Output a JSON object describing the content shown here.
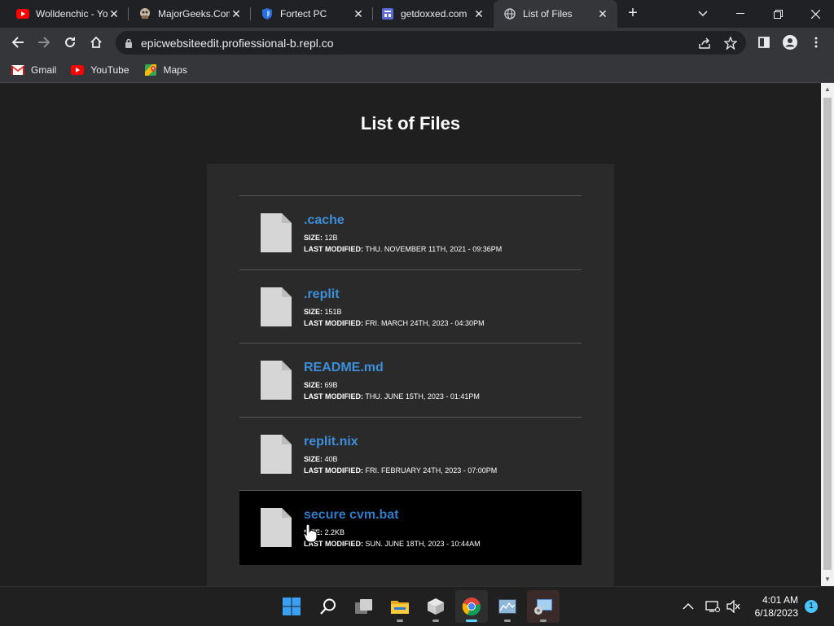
{
  "browser": {
    "tabs": [
      {
        "title": "Wolldenchic - Yo",
        "favicon": "youtube-icon"
      },
      {
        "title": "MajorGeeks.Com",
        "favicon": "majorgeeks-icon"
      },
      {
        "title": "Fortect PC",
        "favicon": "fortect-shield-icon"
      },
      {
        "title": "getdoxxed.com",
        "favicon": "getdoxxed-icon"
      },
      {
        "title": "List of Files",
        "favicon": "globe-icon",
        "active": true
      }
    ],
    "url": "epicwebsiteedit.profiessional-b.repl.co",
    "bookmarks": [
      {
        "label": "Gmail",
        "icon": "gmail-icon"
      },
      {
        "label": "YouTube",
        "icon": "youtube-icon"
      },
      {
        "label": "Maps",
        "icon": "maps-icon"
      }
    ]
  },
  "page": {
    "title": "List of Files",
    "size_label": "SIZE:",
    "modified_label": "LAST MODIFIED:",
    "files": [
      {
        "name": ".cache",
        "size": "12B",
        "modified": "THU. NOVEMBER 11TH, 2021 - 09:36PM"
      },
      {
        "name": ".replit",
        "size": "151B",
        "modified": "FRI. MARCH 24TH, 2023 - 04:30PM"
      },
      {
        "name": "README.md",
        "size": "69B",
        "modified": "THU. JUNE 15TH, 2023 - 01:41PM"
      },
      {
        "name": "replit.nix",
        "size": "40B",
        "modified": "FRI. FEBRUARY 24TH, 2023 - 07:00PM"
      },
      {
        "name": "secure cvm.bat",
        "size": "2.2KB",
        "modified": "SUN. JUNE 18TH, 2023 - 10:44AM",
        "hovered": true
      }
    ]
  },
  "taskbar": {
    "apps": [
      "windows-start-icon",
      "search-icon",
      "task-view-icon",
      "file-explorer-icon",
      "package-icon",
      "chrome-icon",
      "image-app-icon",
      "control-panel-icon"
    ],
    "time": "4:01 AM",
    "date": "6/18/2023",
    "notifications": "1"
  },
  "colors": {
    "link": "#3d8fd9",
    "panel": "#2a2a2a",
    "background": "#1f1f1f"
  }
}
